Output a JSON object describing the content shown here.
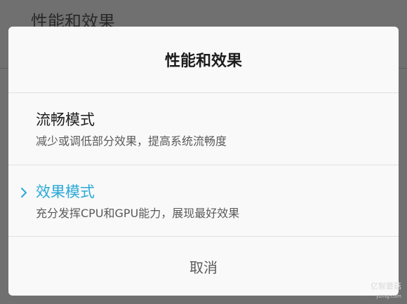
{
  "background": {
    "title": "性能和效果"
  },
  "dialog": {
    "title": "性能和效果",
    "options": [
      {
        "title": "流畅模式",
        "description": "减少或调低部分效果，提高系统流畅度",
        "selected": false
      },
      {
        "title": "效果模式",
        "description": "充分发挥CPU和GPU能力，展现最好效果",
        "selected": true
      }
    ],
    "cancel_label": "取消"
  },
  "watermark": {
    "text": "亿智蘑菇",
    "sub": "yzmg.com"
  },
  "colors": {
    "accent": "#2aa9d8",
    "dialog_bg": "#f9f9f9",
    "overlay": "#707070"
  },
  "icons": {
    "selected_indicator": "chevron-right-icon"
  }
}
